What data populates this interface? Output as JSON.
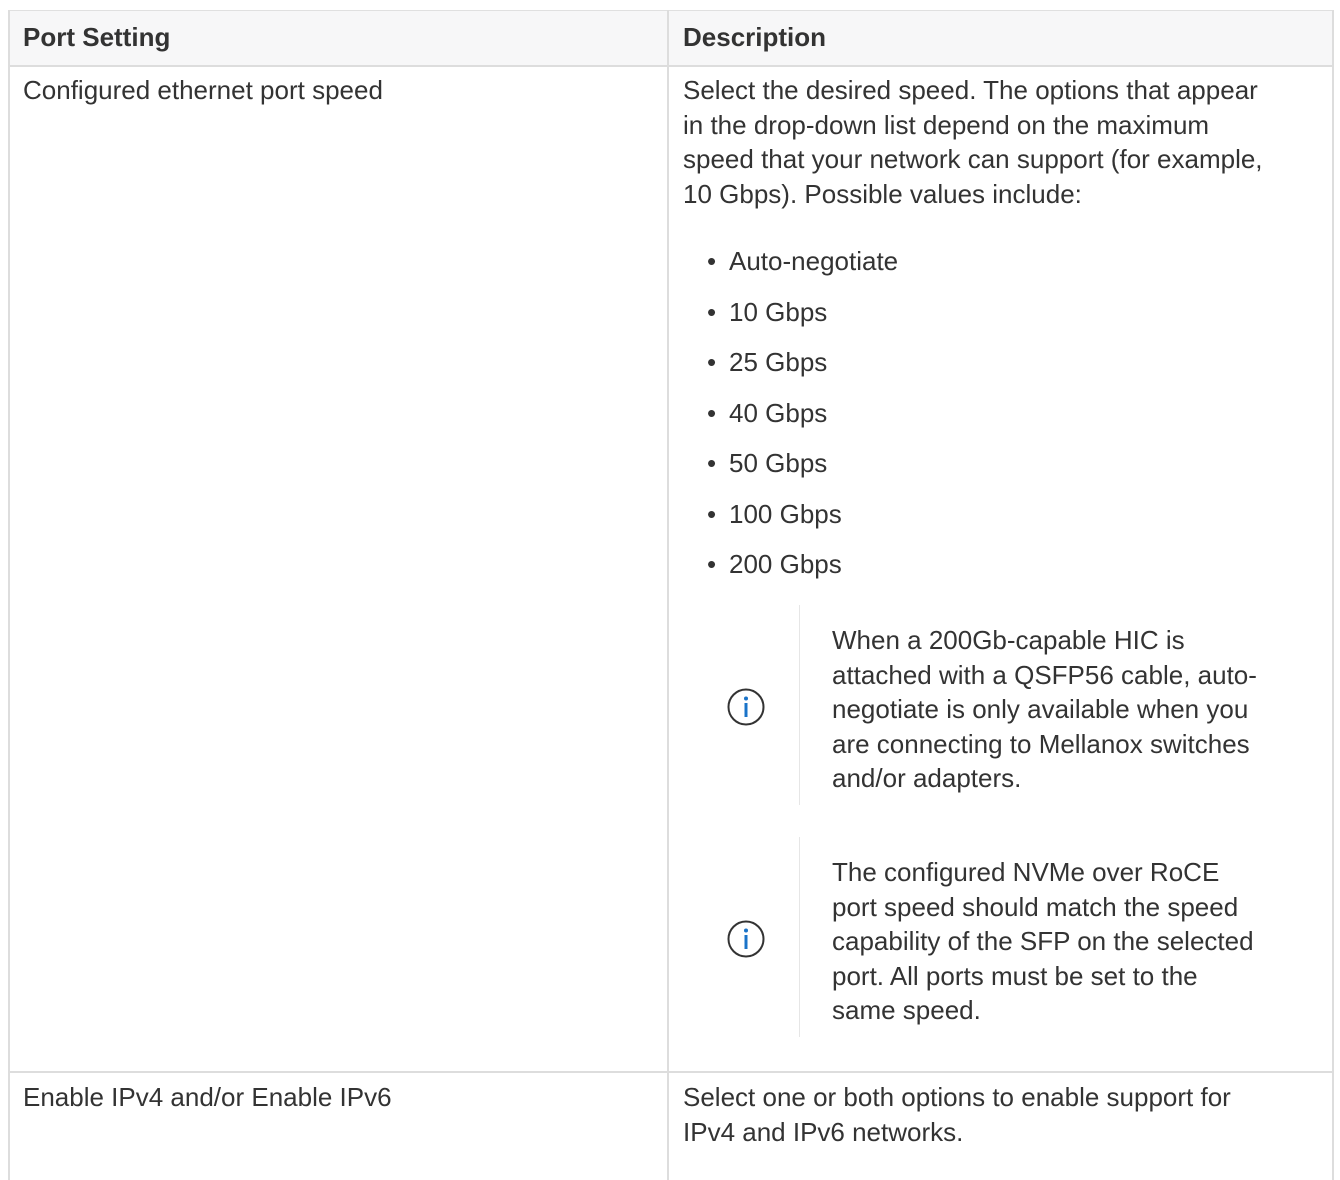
{
  "table": {
    "headers": [
      "Port Setting",
      "Description"
    ],
    "rows": [
      {
        "setting": "Configured ethernet port speed",
        "description": "Select the desired speed. The options that appear in the drop-down list depend on the maximum speed that your network can support (for example, 10 Gbps). Possible values include:",
        "options": [
          "Auto-negotiate",
          "10 Gbps",
          "25 Gbps",
          "40 Gbps",
          "50 Gbps",
          "100 Gbps",
          "200 Gbps"
        ],
        "notes": [
          {
            "icon": "info-icon",
            "lines": [
              "When a 200Gb-capable HIC is",
              "attached with a QSFP56 cable, auto-",
              "negotiate is only available when you",
              "are connecting to Mellanox switches",
              "and/or adapters."
            ]
          },
          {
            "icon": "info-icon",
            "lines": [
              "The configured NVMe over RoCE",
              "port speed should match the speed",
              "capability of the SFP on the selected",
              "port. All ports must be set to the",
              "same speed."
            ]
          }
        ]
      },
      {
        "setting": "Enable IPv4 and/or Enable IPv6",
        "description": "Select one or both options to enable support for IPv4 and IPv6 networks."
      }
    ]
  },
  "desc_lines": {
    "row0": [
      "Select the desired speed. The options that appear",
      "in the drop-down list depend on the maximum",
      "speed that your network can support (for example,",
      "10 Gbps). Possible values include:"
    ],
    "row1": [
      "Select one or both options to enable support for",
      "IPv4 and IPv6 networks."
    ]
  },
  "bullet_glyph": "•",
  "colors": {
    "text": "#333333",
    "border": "#dddddd",
    "header_bg": "#f7f7f8",
    "info_icon": "#1a73c8"
  }
}
